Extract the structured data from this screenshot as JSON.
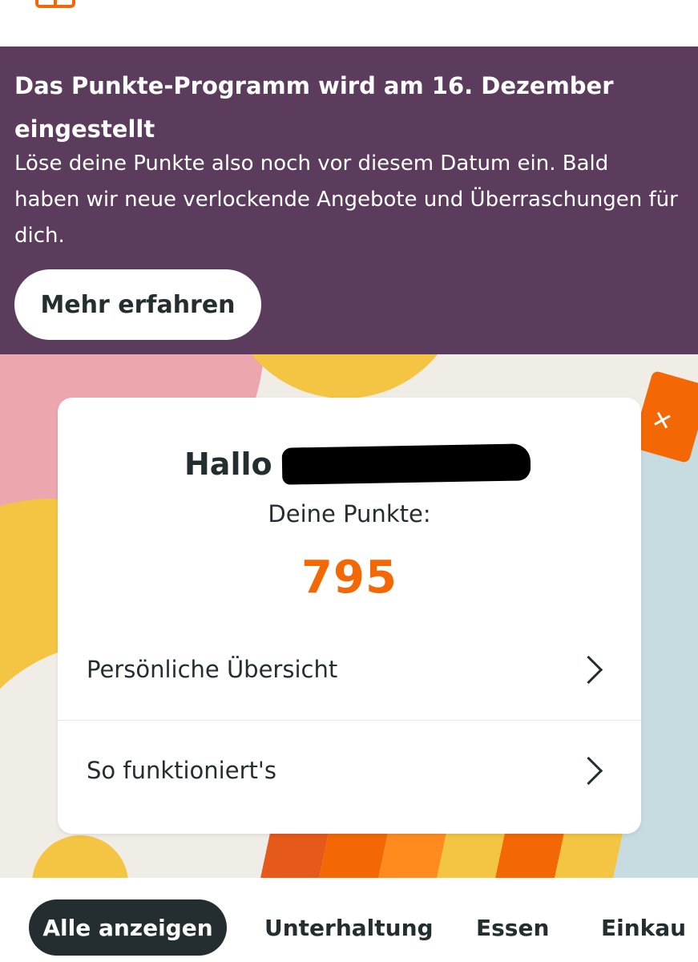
{
  "header": {
    "icon": "bag-icon"
  },
  "banner": {
    "title": "Das Punkte-Programm wird am 16. Dezember eingestellt",
    "body": "Löse deine Punkte also noch vor diesem Datum ein. Bald haben wir neue verlockende Angebote und Überraschungen für dich.",
    "button_label": "Mehr erfahren",
    "background_color": "#5b3c5c"
  },
  "card": {
    "greeting": "Hallo",
    "points_label": "Deine Punkte:",
    "points_value": "795",
    "rows": [
      {
        "label": "Persönliche Übersicht",
        "icon": "chevron-right-icon"
      },
      {
        "label": "So funktioniert's",
        "icon": "chevron-right-icon"
      }
    ]
  },
  "filters": {
    "chips": [
      {
        "label": "Alle anzeigen",
        "active": true
      },
      {
        "label": "Unterhaltung",
        "active": false
      },
      {
        "label": "Essen",
        "active": false
      },
      {
        "label": "Einkau",
        "active": false
      }
    ]
  },
  "colors": {
    "accent": "#f36805",
    "text": "#242e30",
    "pink": "#eda6ae",
    "yellow": "#f4c443",
    "blue": "#c6dce0"
  }
}
